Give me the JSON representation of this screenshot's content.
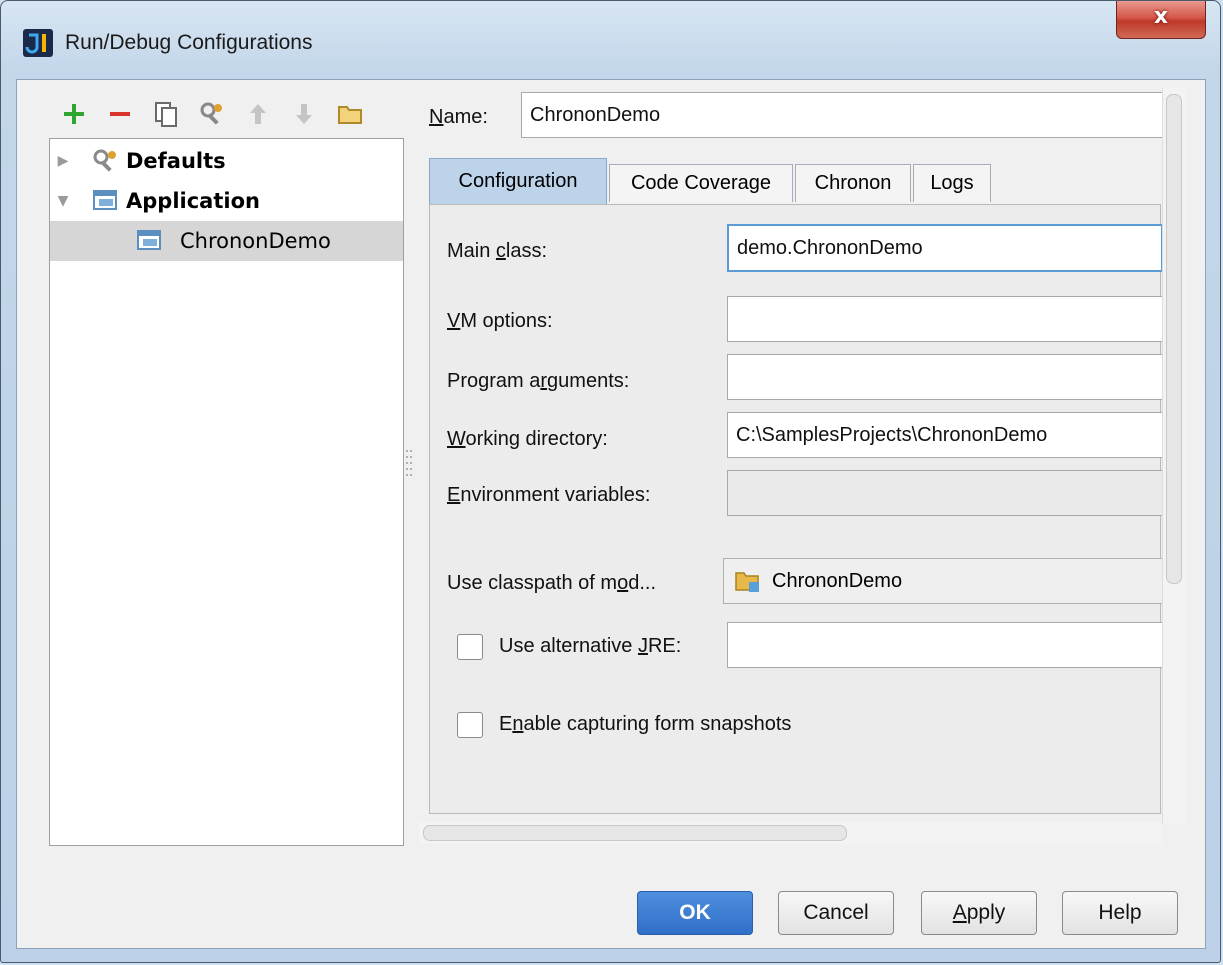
{
  "window": {
    "title": "Run/Debug Configurations",
    "close_glyph": "x"
  },
  "toolbar": {
    "icons": [
      "add-icon",
      "remove-icon",
      "copy-icon",
      "edit-defaults-icon",
      "move-up-icon",
      "move-down-icon",
      "folder-icon"
    ]
  },
  "tree": {
    "items": [
      {
        "label": "Defaults",
        "expanded": false
      },
      {
        "label": "Application",
        "expanded": true
      },
      {
        "label": "ChrononDemo",
        "selected": true
      }
    ]
  },
  "name": {
    "label_u": "N",
    "label_rest": "ame:",
    "value": "ChrononDemo"
  },
  "tabs": [
    {
      "label": "Configuration",
      "active": true
    },
    {
      "label": "Code Coverage"
    },
    {
      "label": "Chronon"
    },
    {
      "label": "Logs"
    }
  ],
  "form": {
    "main_class": {
      "label_a": "Main ",
      "label_u": "c",
      "label_b": "lass:",
      "value": "demo.ChrononDemo"
    },
    "vm_options": {
      "label_u": "V",
      "label_rest": "M options:",
      "value": ""
    },
    "program_arguments": {
      "label_a": "Program a",
      "label_u": "r",
      "label_b": "guments:",
      "value": ""
    },
    "working_directory": {
      "label_u": "W",
      "label_rest": "orking directory:",
      "value": "C:\\SamplesProjects\\ChrononDemo"
    },
    "environment_variables": {
      "label_u": "E",
      "label_rest": "nvironment variables:",
      "value": ""
    },
    "classpath_module": {
      "label_a": "Use classpath of m",
      "label_u": "o",
      "label_b": "d...",
      "value": "ChrononDemo"
    },
    "alternative_jre": {
      "label_a": "Use alternative ",
      "label_u": "J",
      "label_b": "RE:",
      "checked": false,
      "value": ""
    },
    "capture_snapshots": {
      "label_a": "E",
      "label_u": "n",
      "label_b": "able capturing form snapshots",
      "checked": false
    }
  },
  "buttons": {
    "ok": "OK",
    "cancel": "Cancel",
    "apply_u": "A",
    "apply_rest": "pply",
    "help": "Help"
  },
  "colors": {
    "primary_button": "#2f6fc8",
    "active_tab": "#bcd3ea",
    "focus_border": "#5b9bd5",
    "add_icon": "#2ea52e",
    "remove_icon": "#d9342b"
  }
}
